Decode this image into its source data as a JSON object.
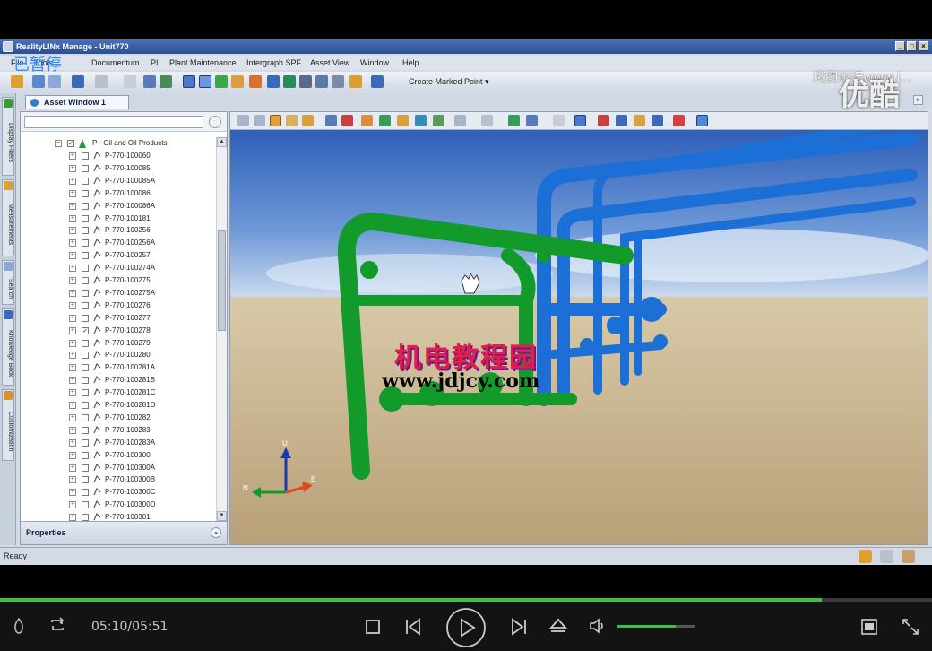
{
  "app": {
    "title": "RealityLINx Manage - Unit770",
    "paused_label": "已暂停",
    "menu": [
      "File",
      "Tools",
      "Documentum",
      "PI",
      "Plant Maintenance",
      "Intergraph SPF",
      "Asset View",
      "Window",
      "Help"
    ],
    "create_marked_point": "Create Marked Point",
    "left_tabs": [
      "Display Filters",
      "Measurements",
      "Search",
      "Knowledge Book",
      "Customization"
    ],
    "doc_tab": "Asset Window 1",
    "tree": {
      "root_label": "P - Oil and Oil Products",
      "items": [
        "P-770-100060",
        "P-770-100085",
        "P-770-100085A",
        "P-770-100086",
        "P-770-100086A",
        "P-770-100181",
        "P-770-100256",
        "P-770-100256A",
        "P-770-100257",
        "P-770-100274A",
        "P-770-100275",
        "P-770-100275A",
        "P-770-100276",
        "P-770-100277",
        "P-770-100278",
        "P-770-100279",
        "P-770-100280",
        "P-770-100281A",
        "P-770-100281B",
        "P-770-100281C",
        "P-770-100281D",
        "P-770-100282",
        "P-770-100283",
        "P-770-100283A",
        "P-770-100300",
        "P-770-100300A",
        "P-770-100300B",
        "P-770-100300C",
        "P-770-100300D",
        "P-770-100301"
      ],
      "checked_item": "P-770-100278"
    },
    "properties_label": "Properties",
    "status": "Ready",
    "axes": {
      "up": "U",
      "east": "E",
      "north": "N"
    }
  },
  "overlays": {
    "forum_watermark": "鹰图论坛www.i...",
    "youku_watermark": "优酷",
    "site_name": "机电教程园",
    "site_url": "www.jdjcy.com"
  },
  "player": {
    "time": "05:10/05:51",
    "progress": 0.882,
    "volume": 0.75,
    "colors": {
      "accent": "#3cc23c",
      "bar": "#131313"
    }
  }
}
